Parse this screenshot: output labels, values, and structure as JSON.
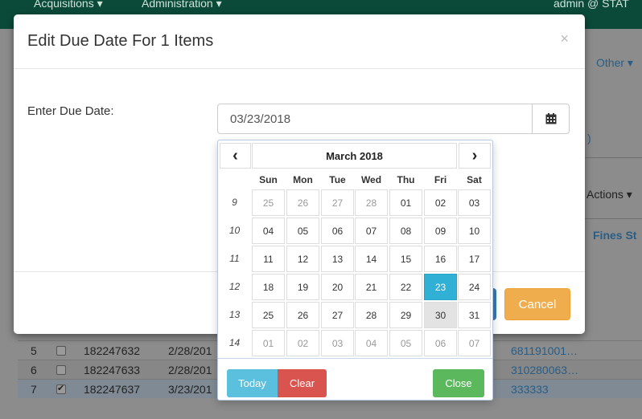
{
  "background": {
    "nav": [
      "Acquisitions ▾",
      "Administration ▾",
      "admin @ STAT"
    ],
    "other_menu": "Other ▾",
    "partial_text": ")",
    "actions_menu": "Actions ▾",
    "fines_header": "Fines St",
    "rows": [
      {
        "num": "5",
        "barcode": "182247632",
        "date": "2/28/201",
        "item": "681191001…",
        "checked": false
      },
      {
        "num": "6",
        "barcode": "182247633",
        "date": "2/28/201",
        "item": "310280063…",
        "checked": false
      },
      {
        "num": "7",
        "barcode": "182247637",
        "date": "3/23/201",
        "item": "333333",
        "checked": true
      }
    ]
  },
  "modal": {
    "title": "Edit Due Date For 1 Items",
    "close_glyph": "×",
    "field_label": "Enter Due Date:",
    "date_value": "03/23/2018",
    "cancel_label": "Cancel"
  },
  "datepicker": {
    "month_label": "March 2018",
    "prev_glyph": "‹",
    "next_glyph": "›",
    "weekdays": [
      "Sun",
      "Mon",
      "Tue",
      "Wed",
      "Thu",
      "Fri",
      "Sat"
    ],
    "weeks": [
      {
        "week": "9",
        "days": [
          "25",
          "26",
          "27",
          "28",
          "01",
          "02",
          "03"
        ]
      },
      {
        "week": "10",
        "days": [
          "04",
          "05",
          "06",
          "07",
          "08",
          "09",
          "10"
        ]
      },
      {
        "week": "11",
        "days": [
          "11",
          "12",
          "13",
          "14",
          "15",
          "16",
          "17"
        ]
      },
      {
        "week": "12",
        "days": [
          "18",
          "19",
          "20",
          "21",
          "22",
          "23",
          "24"
        ]
      },
      {
        "week": "13",
        "days": [
          "25",
          "26",
          "27",
          "28",
          "29",
          "30",
          "31"
        ]
      },
      {
        "week": "14",
        "days": [
          "01",
          "02",
          "03",
          "04",
          "05",
          "06",
          "07"
        ]
      }
    ],
    "muted_cells": [
      [
        0,
        0
      ],
      [
        0,
        1
      ],
      [
        0,
        2
      ],
      [
        0,
        3
      ],
      [
        5,
        0
      ],
      [
        5,
        1
      ],
      [
        5,
        2
      ],
      [
        5,
        3
      ],
      [
        5,
        4
      ],
      [
        5,
        5
      ],
      [
        5,
        6
      ]
    ],
    "selected_cell": [
      3,
      5
    ],
    "today_cell": [
      4,
      5
    ],
    "today_label": "Today",
    "clear_label": "Clear",
    "close_label": "Close"
  },
  "colors": {
    "selected": "#31b0d5",
    "today_btn": "#5bc0de",
    "clear_btn": "#d9534f",
    "close_btn": "#5cb85c",
    "cancel_btn": "#f0ad4e",
    "topbar": "#0b4a39"
  }
}
